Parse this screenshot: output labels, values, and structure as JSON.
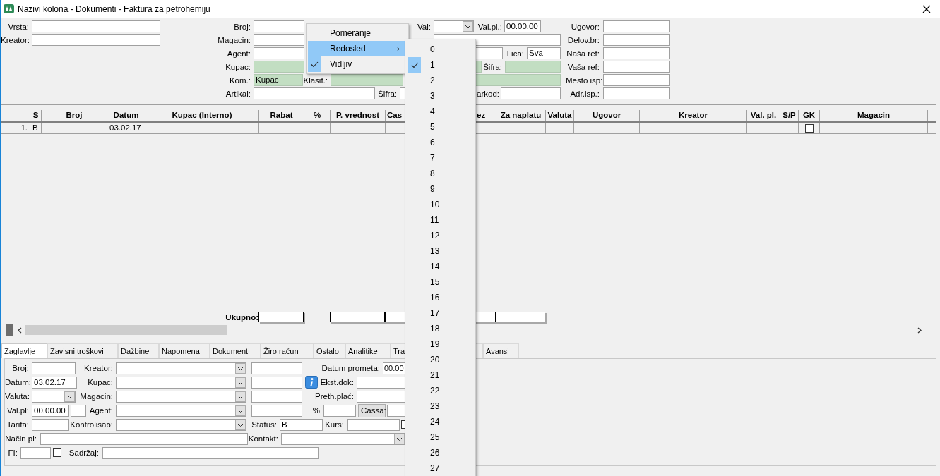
{
  "window": {
    "title": "Nazivi kolona - Dokumenti - Faktura za petrohemiju"
  },
  "filter_rows": [
    {
      "items": [
        {
          "kind": "label",
          "text": "Vrsta:"
        },
        {
          "kind": "field"
        },
        {
          "kind": "label",
          "text": "Broj:"
        },
        {
          "kind": "field"
        },
        {
          "kind": "label",
          "text": "Val:"
        },
        {
          "kind": "combo"
        },
        {
          "kind": "label",
          "text": "Val.pl.:"
        },
        {
          "kind": "field",
          "value": "00.00.00"
        },
        {
          "kind": "label",
          "text": "Ugovor:"
        },
        {
          "kind": "field"
        }
      ]
    },
    {
      "items": [
        {
          "kind": "label",
          "text": "Kreator:"
        },
        {
          "kind": "field"
        },
        {
          "kind": "label",
          "text": "Magacin:"
        },
        {
          "kind": "field"
        },
        {
          "kind": "field"
        },
        {
          "kind": "label",
          "text": "Delov.br:"
        },
        {
          "kind": "field"
        }
      ]
    },
    {
      "items": [
        {
          "kind": "label",
          "text": "Agent:"
        },
        {
          "kind": "field"
        },
        {
          "kind": "field"
        },
        {
          "kind": "label",
          "text": "Lica:"
        },
        {
          "kind": "field",
          "value": "Sva"
        },
        {
          "kind": "label",
          "text": "Naša ref:"
        },
        {
          "kind": "field"
        }
      ]
    },
    {
      "items": [
        {
          "kind": "label",
          "text": "Kupac:"
        },
        {
          "kind": "lookup"
        },
        {
          "kind": "lookup"
        },
        {
          "kind": "label",
          "text": "Šifra:"
        },
        {
          "kind": "lookup"
        },
        {
          "kind": "label",
          "text": "Vaša ref:"
        },
        {
          "kind": "field"
        }
      ]
    },
    {
      "items": [
        {
          "kind": "label",
          "text": "Kom.:"
        },
        {
          "kind": "lookup",
          "value": "Kupac"
        },
        {
          "kind": "label",
          "text": "Klasif.:"
        },
        {
          "kind": "lookup"
        },
        {
          "kind": "lookup"
        },
        {
          "kind": "label",
          "text": "Mesto isp:"
        },
        {
          "kind": "field"
        }
      ]
    },
    {
      "items": [
        {
          "kind": "label",
          "text": "Artikal:"
        },
        {
          "kind": "field"
        },
        {
          "kind": "label",
          "text": "Šifra:"
        },
        {
          "kind": "field"
        },
        {
          "kind": "label",
          "text": "arkod:"
        },
        {
          "kind": "field"
        },
        {
          "kind": "label",
          "text": "Adr.isp.:"
        },
        {
          "kind": "field"
        }
      ]
    }
  ],
  "table": {
    "columns": [
      {
        "label": "S"
      },
      {
        "label": "Broj"
      },
      {
        "label": "Datum"
      },
      {
        "label": "Kupac (Interno)"
      },
      {
        "label": "Rabat"
      },
      {
        "label": "%"
      },
      {
        "label": "P. vrednost"
      },
      {
        "label": "Cas"
      },
      {
        "label": "ez"
      },
      {
        "label": "Za naplatu"
      },
      {
        "label": "Valuta"
      },
      {
        "label": "Ugovor"
      },
      {
        "label": "Kreator"
      },
      {
        "label": "Val. pl."
      },
      {
        "label": "S/P"
      },
      {
        "label": "GK"
      },
      {
        "label": "Magacin"
      }
    ],
    "rows": [
      {
        "number": "1.",
        "s": "B",
        "datum": "03.02.17",
        "gk_checked": false
      }
    ],
    "totals_label": "Ukupno:"
  },
  "tabs": [
    {
      "label": "Zaglavlje",
      "selected": true
    },
    {
      "label": "Zavisni troškovi",
      "selected": false
    },
    {
      "label": "Dažbine",
      "selected": false
    },
    {
      "label": "Napomena",
      "selected": false
    },
    {
      "label": "Dokumenti",
      "selected": false
    },
    {
      "label": "Žiro račun",
      "selected": false
    },
    {
      "label": "Ostalo",
      "selected": false
    },
    {
      "label": "Analitike",
      "selected": false
    },
    {
      "label": "Tra",
      "selected": false
    },
    {
      "label": "Avansi",
      "selected": false
    }
  ],
  "form_rows": [
    {
      "items": [
        {
          "kind": "label",
          "text": "Broj:"
        },
        {
          "kind": "field"
        },
        {
          "kind": "label",
          "text": "Kreator:"
        },
        {
          "kind": "combo"
        },
        {
          "kind": "field"
        },
        {
          "kind": "label",
          "text": "Datum prometa:"
        },
        {
          "kind": "field",
          "value": "00.00"
        }
      ]
    },
    {
      "items": [
        {
          "kind": "label",
          "text": "Datum:"
        },
        {
          "kind": "field",
          "value": "03.02.17"
        },
        {
          "kind": "label",
          "text": "Kupac:"
        },
        {
          "kind": "combo"
        },
        {
          "kind": "field"
        },
        {
          "kind": "label",
          "text": "Ekst.dok:"
        },
        {
          "kind": "field"
        }
      ]
    },
    {
      "items": [
        {
          "kind": "label",
          "text": "Valuta:"
        },
        {
          "kind": "combo"
        },
        {
          "kind": "label",
          "text": "Magacin:"
        },
        {
          "kind": "combo"
        },
        {
          "kind": "field"
        },
        {
          "kind": "label",
          "text": "Preth.plać:"
        },
        {
          "kind": "field"
        }
      ]
    },
    {
      "items": [
        {
          "kind": "label",
          "text": "Val.pl:"
        },
        {
          "kind": "field",
          "value": "00.00.00"
        },
        {
          "kind": "field"
        },
        {
          "kind": "label",
          "text": "Agent:"
        },
        {
          "kind": "combo"
        },
        {
          "kind": "field"
        },
        {
          "kind": "label",
          "text": "%"
        },
        {
          "kind": "field"
        },
        {
          "kind": "button",
          "text": "Cassa:"
        },
        {
          "kind": "field"
        }
      ]
    },
    {
      "items": [
        {
          "kind": "label",
          "text": "Tarifa:"
        },
        {
          "kind": "field"
        },
        {
          "kind": "label",
          "text": "Kontrolisao:"
        },
        {
          "kind": "combo"
        },
        {
          "kind": "label",
          "text": "Status:"
        },
        {
          "kind": "field",
          "value": "B"
        },
        {
          "kind": "label",
          "text": "Kurs:"
        },
        {
          "kind": "field"
        },
        {
          "kind": "checkbox",
          "checked": false
        }
      ]
    },
    {
      "items": [
        {
          "kind": "label",
          "text": "Način pl:"
        },
        {
          "kind": "field"
        },
        {
          "kind": "label",
          "text": "Kontakt:"
        },
        {
          "kind": "combo"
        }
      ]
    },
    {
      "items": [
        {
          "kind": "label",
          "text": "FI:"
        },
        {
          "kind": "field"
        },
        {
          "kind": "checkbox",
          "checked": false
        },
        {
          "kind": "label",
          "text": "Sadržaj:"
        },
        {
          "kind": "field"
        }
      ]
    }
  ],
  "context_menu": {
    "items": [
      {
        "label": "Pomeranje",
        "selected": false,
        "checked": false,
        "submenu": false
      },
      {
        "label": "Redosled",
        "selected": true,
        "checked": false,
        "submenu": true
      },
      {
        "label": "Vidljiv",
        "selected": false,
        "checked": true,
        "submenu": false
      }
    ]
  },
  "submenu": {
    "items": [
      {
        "label": "0",
        "checked": false
      },
      {
        "label": "1",
        "checked": true
      },
      {
        "label": "2",
        "checked": false
      },
      {
        "label": "3",
        "checked": false
      },
      {
        "label": "4",
        "checked": false
      },
      {
        "label": "5",
        "checked": false
      },
      {
        "label": "6",
        "checked": false
      },
      {
        "label": "7",
        "checked": false
      },
      {
        "label": "8",
        "checked": false
      },
      {
        "label": "9",
        "checked": false
      },
      {
        "label": "10",
        "checked": false
      },
      {
        "label": "11",
        "checked": false
      },
      {
        "label": "12",
        "checked": false
      },
      {
        "label": "13",
        "checked": false
      },
      {
        "label": "14",
        "checked": false
      },
      {
        "label": "15",
        "checked": false
      },
      {
        "label": "16",
        "checked": false
      },
      {
        "label": "17",
        "checked": false
      },
      {
        "label": "18",
        "checked": false
      },
      {
        "label": "19",
        "checked": false
      },
      {
        "label": "20",
        "checked": false
      },
      {
        "label": "21",
        "checked": false
      },
      {
        "label": "22",
        "checked": false
      },
      {
        "label": "23",
        "checked": false
      },
      {
        "label": "24",
        "checked": false
      },
      {
        "label": "25",
        "checked": false
      },
      {
        "label": "26",
        "checked": false
      },
      {
        "label": "27",
        "checked": false
      }
    ]
  }
}
